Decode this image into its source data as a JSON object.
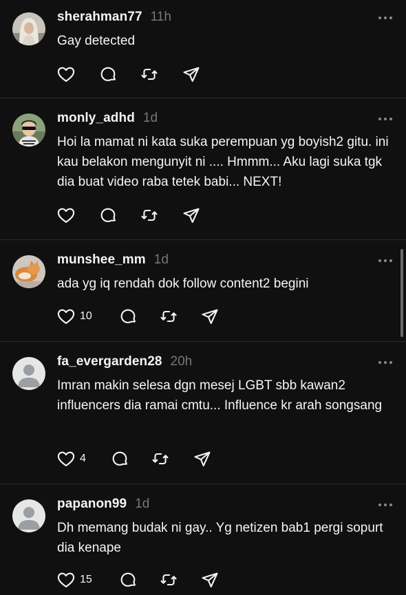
{
  "posts": [
    {
      "username": "sherahman77",
      "time": "11h",
      "text": "Gay detected",
      "likes": "",
      "avatar": "photo-hijab-avatar"
    },
    {
      "username": "monly_adhd",
      "time": "1d",
      "text": "Hoi la mamat ni kata suka perempuan yg boyish2 gitu. ini kau belakon mengunyit ni .... Hmmm... Aku lagi suka tgk dia buat video raba tetek babi... NEXT!",
      "likes": "",
      "avatar": "photo-sunglasses-avatar"
    },
    {
      "username": "munshee_mm",
      "time": "1d",
      "text": "ada yg iq rendah dok follow content2 begini",
      "likes": "10",
      "avatar": "photo-cat-avatar"
    },
    {
      "username": "fa_evergarden28",
      "time": "20h",
      "text": "Imran makin selesa dgn mesej LGBT sbb kawan2 influencers dia ramai cmtu... Influence kr arah songsang",
      "likes": "4",
      "avatar": "default-person-avatar"
    },
    {
      "username": "papanon99",
      "time": "1d",
      "text": "Dh memang budak ni gay.. Yg netizen bab1 pergi sopurt dia kenape",
      "likes": "15",
      "avatar": "default-person-avatar"
    }
  ],
  "icons": {
    "like": "heart-icon",
    "reply": "comment-icon",
    "repost": "repost-icon",
    "share": "send-icon",
    "more": "more-icon"
  },
  "colors": {
    "background": "#101010",
    "text": "#f3f5f7",
    "muted": "#777777",
    "divider": "#2b2b2b"
  }
}
